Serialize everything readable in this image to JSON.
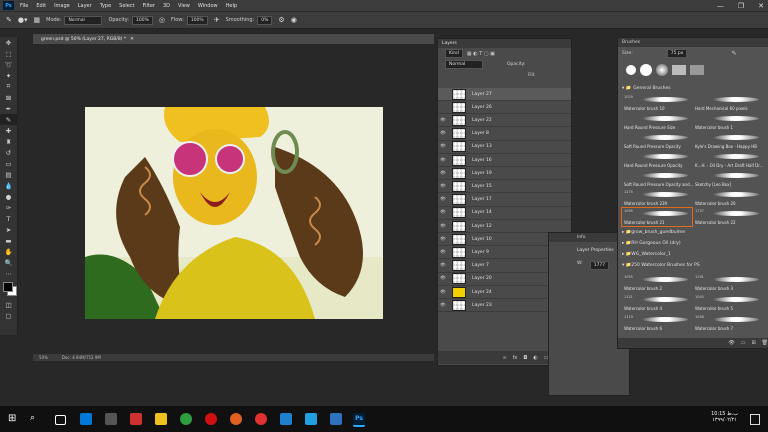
{
  "menubar": {
    "logo": "Ps",
    "items": [
      "File",
      "Edit",
      "Image",
      "Layer",
      "Type",
      "Select",
      "Filter",
      "3D",
      "View",
      "Window",
      "Help"
    ],
    "min": "—",
    "max": "❐",
    "close": "✕"
  },
  "options": {
    "mode_label": "Mode:",
    "mode_value": "Normal",
    "opacity_label": "Opacity:",
    "opacity_value": "100%",
    "flow_label": "Flow:",
    "flow_value": "100%",
    "smoothing_label": "Smoothing:",
    "smoothing_value": "0%"
  },
  "document": {
    "tab_title": "green.psd @ 50% (Layer 27, RGB/8) *",
    "zoom": "50%",
    "doc_size": "Doc: 4.94M/752.9M"
  },
  "layers": {
    "title": "Layers",
    "kind": "Kind",
    "mode": "Normal",
    "opacity_label": "Opacity:",
    "fill_label": "Fill:",
    "items": [
      "Layer 27",
      "Layer 26",
      "Layer 22",
      "Layer 8",
      "Layer 13",
      "Layer 16",
      "Layer 19",
      "Layer 15",
      "Layer 17",
      "Layer 14",
      "Layer 12",
      "Layer 10",
      "Layer 9",
      "Layer 7",
      "Layer 20",
      "Layer 24",
      "Layer 23"
    ]
  },
  "properties": {
    "title": "Layer Properties",
    "w_label": "W:",
    "w_value": "1777",
    "info_tab": "Info"
  },
  "brushes": {
    "title": "Brushes",
    "size_label": "Size:",
    "size_value": "75 px",
    "general_folder": "General Brushes",
    "items": [
      {
        "num": "1029",
        "name": "Watercolor brush 10"
      },
      {
        "num": "",
        "name": "Hard Mechanical 60 pixels"
      },
      {
        "num": "",
        "name": "Hard Round Pressure Size"
      },
      {
        "num": "",
        "name": "Watercolor brush 1"
      },
      {
        "num": "",
        "name": "Soft Round Pressure Opacity"
      },
      {
        "num": "",
        "name": "Kyle's Drawing Box - Happy HB"
      },
      {
        "num": "",
        "name": "Hard Round Pressure Opacity"
      },
      {
        "num": "",
        "name": "K...H. - Oil Dry - Art Draft Half Dr..."
      },
      {
        "num": "",
        "name": "Soft Round Pressure Opacity and..."
      },
      {
        "num": "",
        "name": "Sketchy [Leo Box]"
      },
      {
        "num": "1275",
        "name": "Watercolor brush 239"
      },
      {
        "num": "",
        "name": "Watercolor brush 20"
      },
      {
        "num": "1095",
        "name": "Watercolor brush 21"
      },
      {
        "num": "1737",
        "name": "Watercolor brush 22"
      }
    ],
    "folders": [
      "grow_brush_guedbulme",
      "RH Gorgeous Oil (dry)",
      "WG_Watercolor_1",
      "250 Watercolor Brushes for PS"
    ],
    "wc_items": [
      {
        "num": "1055",
        "name": "Watercolor brush 2"
      },
      {
        "num": "1191",
        "name": "Watercolor brush 3"
      },
      {
        "num": "1121",
        "name": "Watercolor brush 4"
      },
      {
        "num": "1045",
        "name": "Watercolor brush 5"
      },
      {
        "num": "1119",
        "name": "Watercolor brush 6"
      },
      {
        "num": "1046",
        "name": "Watercolor brush 7"
      }
    ]
  },
  "taskbar": {
    "time": "10:15 ب.ظ",
    "date": "۱۳۹۹/۰۲/۲۱"
  },
  "colors": {
    "foreground": "#000000",
    "background": "#ffffff",
    "accent": "#31a8ff"
  }
}
